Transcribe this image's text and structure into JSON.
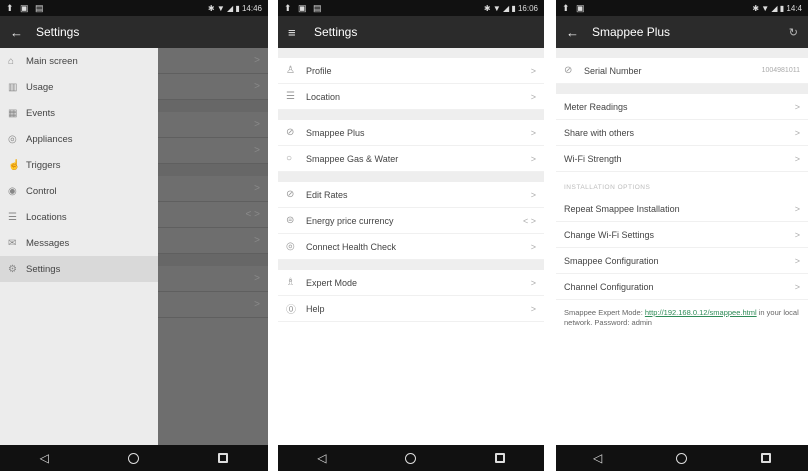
{
  "screen1": {
    "status_left": "⬆ ▣ ▤",
    "status_right": "✱ ▼ ◢ ▮ 14:46",
    "title": "Settings",
    "drawer_items": [
      {
        "label": "Main screen",
        "icon": "home-icon"
      },
      {
        "label": "Usage",
        "icon": "chart-icon"
      },
      {
        "label": "Events",
        "icon": "calendar-icon"
      },
      {
        "label": "Appliances",
        "icon": "appliance-icon"
      },
      {
        "label": "Triggers",
        "icon": "trigger-icon"
      },
      {
        "label": "Control",
        "icon": "control-icon"
      },
      {
        "label": "Locations",
        "icon": "location-icon"
      },
      {
        "label": "Messages",
        "icon": "message-icon"
      },
      {
        "label": "Settings",
        "icon": "gear-icon"
      }
    ]
  },
  "screen2": {
    "status_left": "⬆ ▣ ▤",
    "status_right": "✱ ▼ ◢ ▮ 16:06",
    "title": "Settings",
    "groups": [
      [
        {
          "label": "Profile",
          "icon": "person-icon"
        },
        {
          "label": "Location",
          "icon": "location-icon"
        }
      ],
      [
        {
          "label": "Smappee Plus",
          "icon": "plug-icon"
        },
        {
          "label": "Smappee Gas & Water",
          "icon": "drop-icon"
        }
      ],
      [
        {
          "label": "Edit Rates",
          "icon": "rate-icon"
        },
        {
          "label": "Energy price currency",
          "icon": "currency-icon"
        },
        {
          "label": "Connect Health Check",
          "icon": "health-icon"
        }
      ],
      [
        {
          "label": "Expert Mode",
          "icon": "expert-icon"
        },
        {
          "label": "Help",
          "icon": "help-icon"
        }
      ]
    ]
  },
  "screen3": {
    "status_left": "⬆ ▣",
    "status_right": "✱ ▼ ◢ ▮ 14:4",
    "title": "Smappee Plus",
    "serial_label": "Serial Number",
    "serial_value": "1004981011",
    "rows1": [
      "Meter Readings",
      "Share with others",
      "Wi-Fi Strength"
    ],
    "section_header": "INSTALLATION OPTIONS",
    "rows2": [
      "Repeat Smappee Installation",
      "Change Wi-Fi Settings",
      "Smappee Configuration",
      "Channel Configuration"
    ],
    "note_prefix": "Smappee Expert Mode: ",
    "note_link": "http://192.168.0.12/smappee.html",
    "note_suffix": " in your local network. Password: admin"
  }
}
